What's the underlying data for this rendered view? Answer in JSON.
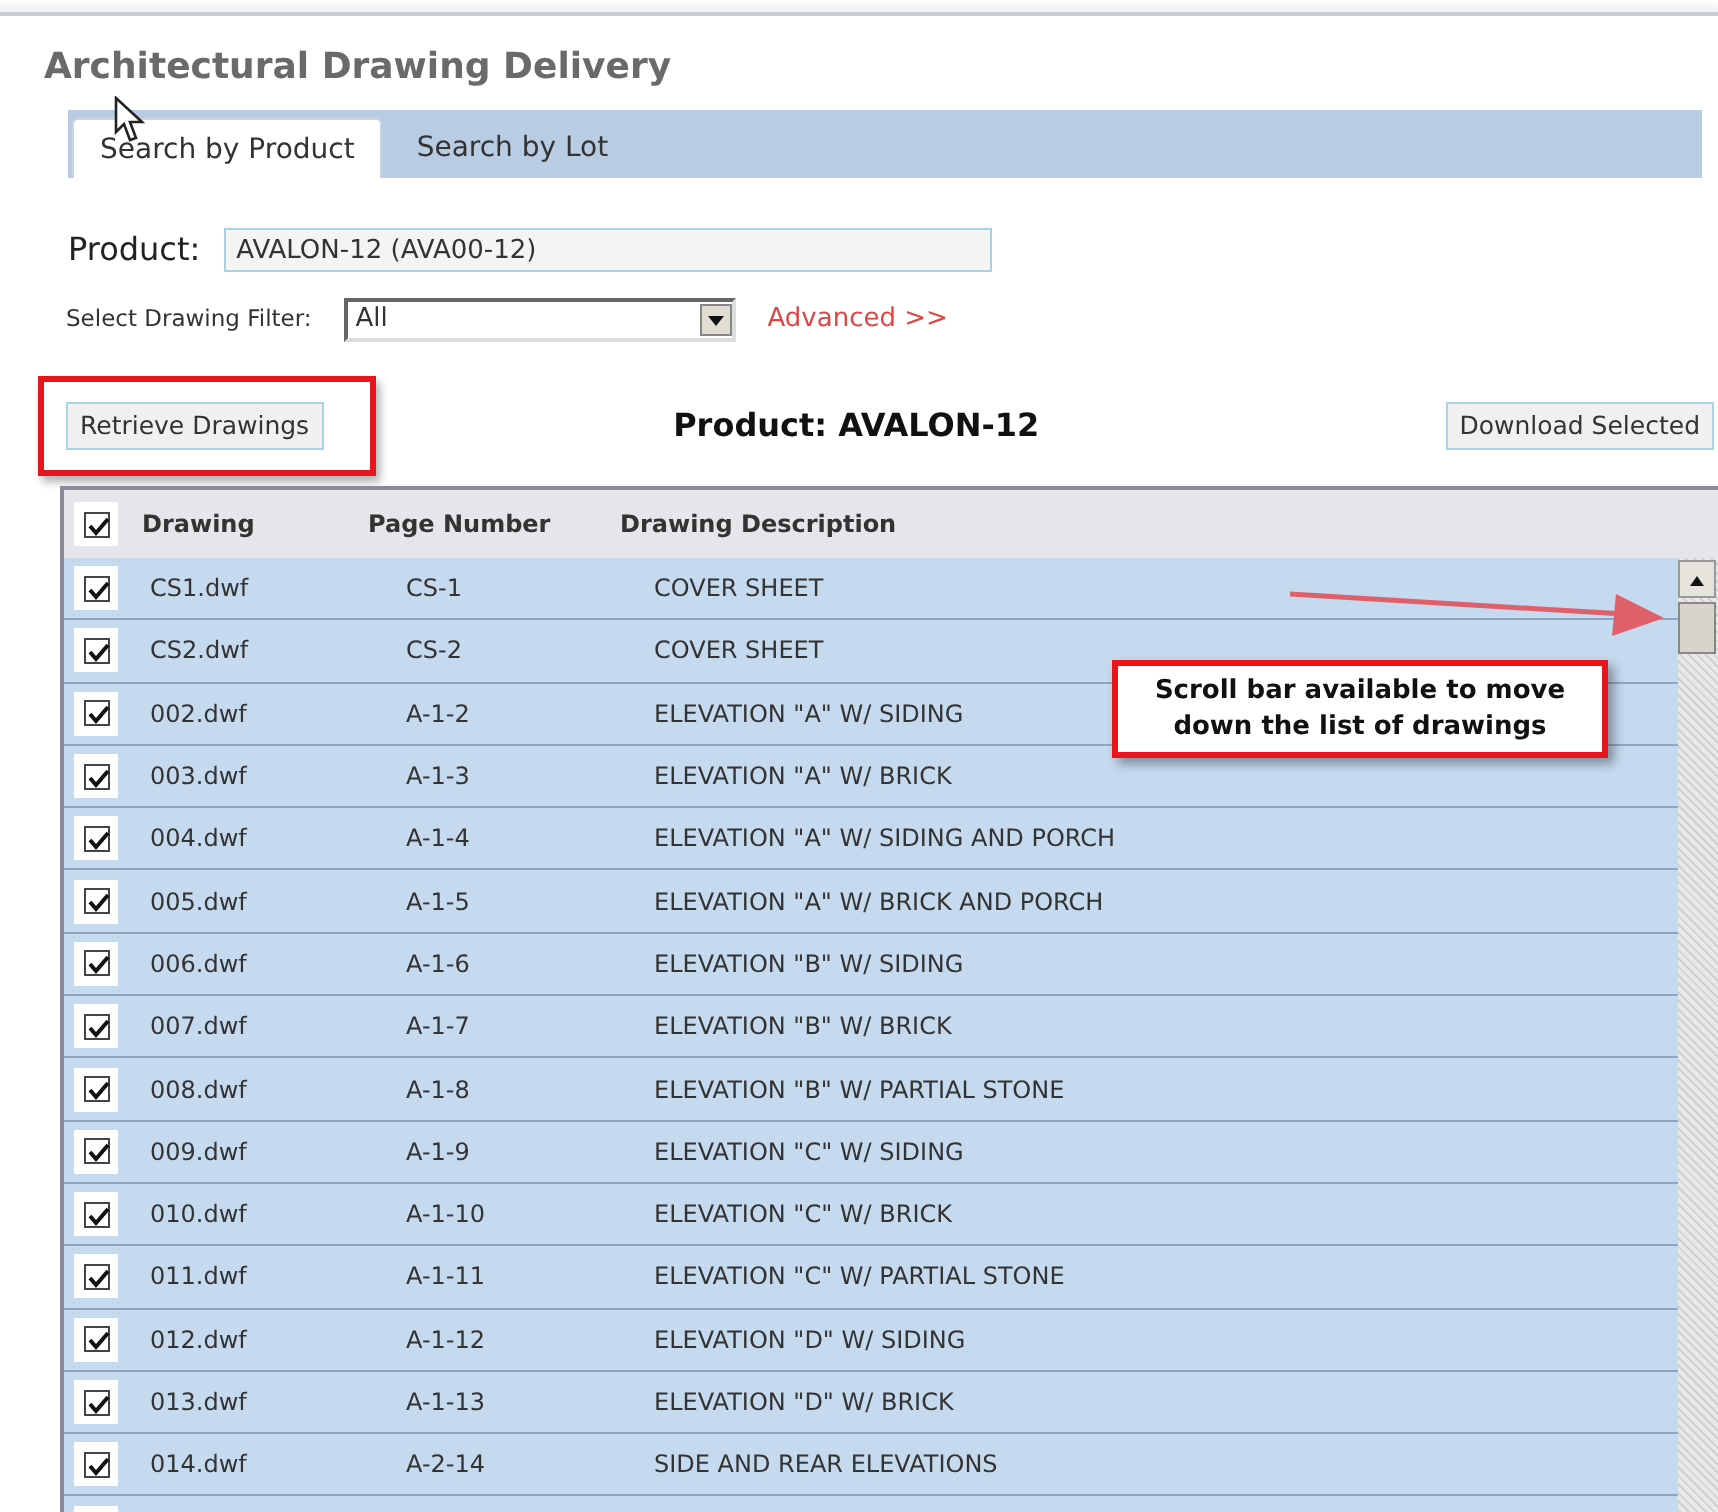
{
  "page": {
    "title": "Architectural Drawing Delivery"
  },
  "tabs": [
    {
      "label": "Search by Product",
      "selected": true
    },
    {
      "label": "Search by Lot",
      "selected": false
    }
  ],
  "product": {
    "label": "Product:",
    "value": "AVALON-12 (AVA00-12)"
  },
  "filter": {
    "label": "Select Drawing Filter:",
    "value": "All",
    "advanced_link": "Advanced >>"
  },
  "retrieve_button": "Retrieve Drawings",
  "product_heading": "Product: AVALON-12",
  "download_button": "Download Selected",
  "table": {
    "select_all_checked": true,
    "columns": [
      "Drawing",
      "Page Number",
      "Drawing Description"
    ],
    "rows": [
      {
        "checked": true,
        "drawing": "CS1.dwf",
        "page": "CS-1",
        "description": "COVER SHEET"
      },
      {
        "checked": true,
        "drawing": "CS2.dwf",
        "page": "CS-2",
        "description": "COVER SHEET"
      },
      {
        "checked": true,
        "drawing": "002.dwf",
        "page": "A-1-2",
        "description": "ELEVATION \"A\" W/ SIDING"
      },
      {
        "checked": true,
        "drawing": "003.dwf",
        "page": "A-1-3",
        "description": "ELEVATION \"A\" W/ BRICK"
      },
      {
        "checked": true,
        "drawing": "004.dwf",
        "page": "A-1-4",
        "description": "ELEVATION \"A\" W/ SIDING AND PORCH"
      },
      {
        "checked": true,
        "drawing": "005.dwf",
        "page": "A-1-5",
        "description": "ELEVATION \"A\" W/ BRICK AND PORCH"
      },
      {
        "checked": true,
        "drawing": "006.dwf",
        "page": "A-1-6",
        "description": "ELEVATION \"B\" W/ SIDING"
      },
      {
        "checked": true,
        "drawing": "007.dwf",
        "page": "A-1-7",
        "description": "ELEVATION \"B\" W/ BRICK"
      },
      {
        "checked": true,
        "drawing": "008.dwf",
        "page": "A-1-8",
        "description": "ELEVATION \"B\" W/ PARTIAL STONE"
      },
      {
        "checked": true,
        "drawing": "009.dwf",
        "page": "A-1-9",
        "description": "ELEVATION \"C\" W/ SIDING"
      },
      {
        "checked": true,
        "drawing": "010.dwf",
        "page": "A-1-10",
        "description": "ELEVATION \"C\" W/ BRICK"
      },
      {
        "checked": true,
        "drawing": "011.dwf",
        "page": "A-1-11",
        "description": "ELEVATION \"C\" W/ PARTIAL STONE"
      },
      {
        "checked": true,
        "drawing": "012.dwf",
        "page": "A-1-12",
        "description": "ELEVATION \"D\" W/ SIDING"
      },
      {
        "checked": true,
        "drawing": "013.dwf",
        "page": "A-1-13",
        "description": "ELEVATION \"D\" W/ BRICK"
      },
      {
        "checked": true,
        "drawing": "014.dwf",
        "page": "A-2-14",
        "description": "SIDE AND REAR ELEVATIONS"
      }
    ]
  },
  "callout": {
    "text": "Scroll bar available to move down the list of drawings"
  }
}
